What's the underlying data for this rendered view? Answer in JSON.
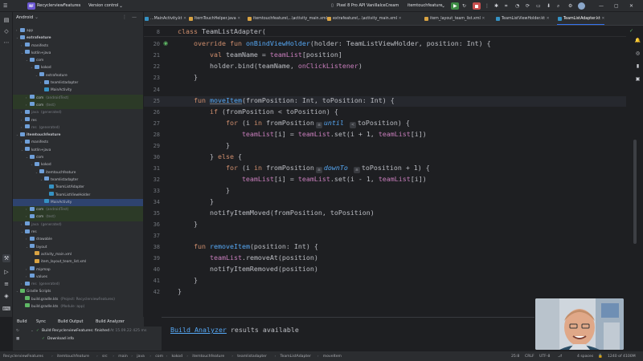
{
  "titlebar": {
    "project_badge": "RF",
    "project_name": "RecyclerviewFeatures",
    "vcs": "Version control",
    "device": "Pixel 8 Pro API VanillaIceCream",
    "run_config": "itemtouchfeature"
  },
  "project_panel": {
    "header": "Android",
    "items": [
      {
        "label": "app",
        "arrow": "›",
        "indent": 0,
        "color": "#6f9fd8"
      },
      {
        "label": "extrafeature",
        "arrow": "⌄",
        "indent": 0,
        "color": "#6f9fd8",
        "bold": true
      },
      {
        "label": "manifests",
        "arrow": "›",
        "indent": 1,
        "color": "#6f9fd8"
      },
      {
        "label": "kotlin+java",
        "arrow": "⌄",
        "indent": 1,
        "color": "#6f9fd8"
      },
      {
        "label": "com",
        "arrow": "⌄",
        "indent": 2,
        "color": "#6f9fd8"
      },
      {
        "label": "kokod",
        "arrow": "⌄",
        "indent": 3,
        "color": "#6f9fd8"
      },
      {
        "label": "extrafeature",
        "arrow": "⌄",
        "indent": 4,
        "color": "#6f9fd8"
      },
      {
        "label": "teamlistadapter",
        "arrow": "›",
        "indent": 5,
        "color": "#6f9fd8"
      },
      {
        "label": "MainActivity",
        "arrow": "",
        "indent": 5,
        "color": "#3592c4"
      },
      {
        "label": "com",
        "note": "(androidTest)",
        "arrow": "›",
        "indent": 2,
        "color": "#6f9fd8",
        "hl": "green"
      },
      {
        "label": "com",
        "note": "(test)",
        "arrow": "›",
        "indent": 2,
        "color": "#6f9fd8",
        "hl": "green"
      },
      {
        "label": "java",
        "note": "(generated)",
        "arrow": "›",
        "indent": 1,
        "color": "#6f9fd8",
        "muted": true
      },
      {
        "label": "res",
        "arrow": "›",
        "indent": 1,
        "color": "#6f9fd8"
      },
      {
        "label": "res",
        "note": "(generated)",
        "arrow": "›",
        "indent": 1,
        "color": "#6f9fd8",
        "muted": true
      },
      {
        "label": "itemtouchfeature",
        "arrow": "⌄",
        "indent": 0,
        "color": "#6f9fd8",
        "bold": true
      },
      {
        "label": "manifests",
        "arrow": "›",
        "indent": 1,
        "color": "#6f9fd8"
      },
      {
        "label": "kotlin+java",
        "arrow": "⌄",
        "indent": 1,
        "color": "#6f9fd8"
      },
      {
        "label": "com",
        "arrow": "⌄",
        "indent": 2,
        "color": "#6f9fd8"
      },
      {
        "label": "kokod",
        "arrow": "⌄",
        "indent": 3,
        "color": "#6f9fd8"
      },
      {
        "label": "itemtouchfeature",
        "arrow": "⌄",
        "indent": 4,
        "color": "#6f9fd8"
      },
      {
        "label": "teamlistadapter",
        "arrow": "⌄",
        "indent": 5,
        "color": "#6f9fd8"
      },
      {
        "label": "TeamListAdapter",
        "arrow": "",
        "indent": 6,
        "color": "#3592c4"
      },
      {
        "label": "TeamListViewHolder",
        "arrow": "",
        "indent": 6,
        "color": "#3592c4"
      },
      {
        "label": "MainActivity",
        "arrow": "",
        "indent": 5,
        "color": "#3592c4",
        "hl": "sel"
      },
      {
        "label": "com",
        "note": "(androidTest)",
        "arrow": "›",
        "indent": 2,
        "color": "#6f9fd8",
        "hl": "green"
      },
      {
        "label": "com",
        "note": "(test)",
        "arrow": "›",
        "indent": 2,
        "color": "#6f9fd8",
        "hl": "green"
      },
      {
        "label": "java",
        "note": "(generated)",
        "arrow": "›",
        "indent": 1,
        "color": "#6f9fd8",
        "muted": true
      },
      {
        "label": "res",
        "arrow": "⌄",
        "indent": 1,
        "color": "#6f9fd8"
      },
      {
        "label": "drawable",
        "arrow": "›",
        "indent": 2,
        "color": "#6f9fd8"
      },
      {
        "label": "layout",
        "arrow": "⌄",
        "indent": 2,
        "color": "#6f9fd8"
      },
      {
        "label": "activity_main.xml",
        "arrow": "",
        "indent": 3,
        "color": "#d9a343"
      },
      {
        "label": "item_layout_team_list.xml",
        "arrow": "",
        "indent": 3,
        "color": "#d9a343"
      },
      {
        "label": "mipmap",
        "arrow": "›",
        "indent": 2,
        "color": "#6f9fd8"
      },
      {
        "label": "values",
        "arrow": "›",
        "indent": 2,
        "color": "#6f9fd8"
      },
      {
        "label": "res",
        "note": "(generated)",
        "arrow": "›",
        "indent": 1,
        "color": "#6f9fd8",
        "muted": true
      },
      {
        "label": "Gradle Scripts",
        "arrow": "⌄",
        "indent": 0,
        "color": "#5fb865"
      },
      {
        "label": "build.gradle.kts",
        "note": "(Project: RecyclerviewFeatures)",
        "arrow": "",
        "indent": 1,
        "color": "#5fb865"
      },
      {
        "label": "build.gradle.kts",
        "note": "(Module :app)",
        "arrow": "",
        "indent": 1,
        "color": "#5fb865"
      }
    ]
  },
  "tabs": [
    {
      "label": "...ΜainActivity.kt",
      "color": "#3592c4",
      "active": false
    },
    {
      "label": "ItemTouchHelper.java",
      "color": "#d9a343",
      "active": false
    },
    {
      "label": "itemtouchfeature\\...\\activity_main.xml",
      "color": "#d9a343",
      "active": false
    },
    {
      "label": "extrafeature\\...\\activity_main.xml",
      "color": "#d9a343",
      "active": false
    },
    {
      "label": "item_layout_team_list.xml",
      "color": "#d9a343",
      "active": false
    },
    {
      "label": "TeamListViewHolder.kt",
      "color": "#3592c4",
      "active": false
    },
    {
      "label": "TeamListAdapter.kt",
      "color": "#3592c4",
      "active": true
    }
  ],
  "editor": {
    "line_numbers": [
      "8",
      "20",
      "21",
      "22",
      "23",
      "24",
      "25",
      "26",
      "27",
      "28",
      "29",
      "30",
      "31",
      "32",
      "33",
      "34",
      "35",
      "36",
      "37",
      "38",
      "39",
      "40",
      "41",
      "42"
    ],
    "lines": [
      [
        [
          "kw",
          "class "
        ],
        [
          "",
          "TeamListAdapter("
        ]
      ],
      [
        [
          "kw",
          "override fun "
        ],
        [
          "fn",
          "onBindViewHolder"
        ],
        [
          "",
          "(holder: TeamListViewHolder, position: Int) {"
        ]
      ],
      [
        [
          "kw",
          "    val "
        ],
        [
          "",
          "teamName = "
        ],
        [
          "pp",
          "teamList"
        ],
        [
          "",
          "[position]"
        ]
      ],
      [
        [
          "",
          "    holder.bind(teamName, "
        ],
        [
          "pp",
          "onClickListener"
        ],
        [
          "",
          ")"
        ]
      ],
      [
        [
          "",
          "}"
        ]
      ],
      [
        [
          "",
          ""
        ]
      ],
      [
        [
          "kw",
          "fun "
        ],
        [
          "fn",
          "moveItem"
        ],
        [
          "",
          "(fromPosition: Int, toPosition: Int) {"
        ]
      ],
      [
        [
          "kw",
          "    if "
        ],
        [
          "",
          "(fromPosition < toPosition) {"
        ]
      ],
      [
        [
          "kw",
          "        for "
        ],
        [
          "",
          "(i "
        ],
        [
          "kw",
          "in "
        ],
        [
          "",
          "fromPosition"
        ],
        [
          "inlay",
          "≤"
        ],
        [
          "it",
          "until "
        ],
        [
          "inlay",
          "<"
        ],
        [
          "",
          "toPosition) {"
        ]
      ],
      [
        [
          "pp",
          "            teamList"
        ],
        [
          "",
          "[i] = "
        ],
        [
          "pp",
          "teamList"
        ],
        [
          "",
          ".set(i + 1, "
        ],
        [
          "pp",
          "teamList"
        ],
        [
          "",
          "[i])"
        ]
      ],
      [
        [
          "",
          "        }"
        ]
      ],
      [
        [
          "",
          "    } "
        ],
        [
          "kw",
          "else "
        ],
        [
          "",
          "{"
        ]
      ],
      [
        [
          "kw",
          "        for "
        ],
        [
          "",
          "(i "
        ],
        [
          "kw",
          "in "
        ],
        [
          "",
          "fromPosition"
        ],
        [
          "inlay",
          "≥"
        ],
        [
          "it",
          "downTo "
        ],
        [
          "inlay",
          "≥"
        ],
        [
          "",
          "toPosition + 1) {"
        ]
      ],
      [
        [
          "pp",
          "            teamList"
        ],
        [
          "",
          "[i] = "
        ],
        [
          "pp",
          "teamList"
        ],
        [
          "",
          ".set(i - 1, "
        ],
        [
          "pp",
          "teamList"
        ],
        [
          "",
          "[i])"
        ]
      ],
      [
        [
          "",
          "        }"
        ]
      ],
      [
        [
          "",
          "    }"
        ]
      ],
      [
        [
          "",
          "    notifyItemMoved(fromPosition, toPosition)"
        ]
      ],
      [
        [
          "",
          "}"
        ]
      ],
      [
        [
          "",
          ""
        ]
      ],
      [
        [
          "kw",
          "fun "
        ],
        [
          "fn",
          "removeItem"
        ],
        [
          "",
          "(position: Int) {"
        ]
      ],
      [
        [
          "pp",
          "    teamList"
        ],
        [
          "",
          ".removeAt(position)"
        ]
      ],
      [
        [
          "",
          "    notifyItemRemoved(position)"
        ]
      ],
      [
        [
          "",
          "}"
        ]
      ],
      [
        [
          "",
          "}"
        ]
      ]
    ]
  },
  "build": {
    "tabs": [
      "Build",
      "Sync",
      "Build Output",
      "Build Analyzer"
    ],
    "task": "Build RecyclerviewFeatures: finished",
    "task_time": "At 15.09.22 425 ms",
    "sub": "Download info",
    "analyzer_link": "Build Analyzer",
    "analyzer_rest": " results available"
  },
  "statusbar": {
    "breadcrumbs": [
      "RecyclerviewFeatures",
      "itemtouchfeature",
      "src",
      "main",
      "java",
      "com",
      "kokod",
      "itemtouchfeature",
      "teamlistadapter",
      "TeamListAdapter",
      "moveItem"
    ],
    "position": "25:8",
    "line_sep": "CRLF",
    "encoding": "UTF-8",
    "indent": "4 spaces",
    "memory": "1240 of 4100M"
  },
  "colors": {
    "accent": "#3574f0",
    "bg_editor": "#1e1f22",
    "bg_panel": "#2b2d30"
  }
}
